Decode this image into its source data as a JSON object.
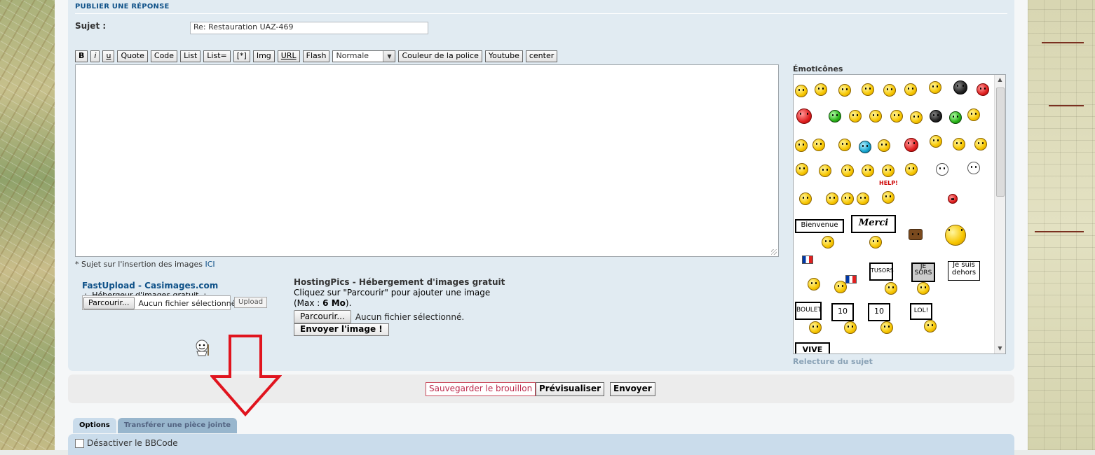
{
  "section": {
    "title": "PUBLIER UNE RÉPONSE"
  },
  "subject": {
    "label": "Sujet :",
    "value": "Re: Restauration UAZ-469"
  },
  "toolbar": {
    "bold": "B",
    "italic": "i",
    "underline": "u",
    "quote": "Quote",
    "code": "Code",
    "list": "List",
    "list_eq": "List=",
    "list_item": "[*]",
    "img": "Img",
    "url": "URL",
    "flash": "Flash",
    "font_size": "Normale",
    "font_color": "Couleur de la police",
    "youtube": "Youtube",
    "center": "center"
  },
  "note": {
    "text": "* Sujet sur l'insertion des images ",
    "link": "ICI"
  },
  "fastupload": {
    "title": "FastUpload - Casimages.com",
    "subtitle": ".:. Hébergeur d'images gratuit .:.",
    "browse": "Parcourir...",
    "no_file": "Aucun fichier sélectionné.",
    "upload": "Upload"
  },
  "hostingpics": {
    "title": "HostingPics - Hébergement d'images gratuit",
    "line1": "Cliquez sur \"Parcourir\" pour ajouter une image",
    "line2_prefix": "(Max : ",
    "line2_bold": "6 Mo",
    "line2_suffix": ").",
    "browse": "Parcourir...",
    "no_file": "Aucun fichier sélectionné.",
    "send": "Envoyer l'image !"
  },
  "emoticons": {
    "title": "Émoticônes",
    "signs": {
      "help": "HELP!",
      "bienvenue": "Bienvenue",
      "merci": "Merci",
      "tusors": "TUSORS",
      "jesors": "JE SORS",
      "dehors": "Je suis dehors",
      "boulet": "BOULET",
      "dix1": "10",
      "dix2": "10",
      "lol": "LOL!",
      "vive": "VIVE"
    }
  },
  "relecture": "Relecture du sujet",
  "buttons": {
    "draft": "Sauvegarder le brouillon",
    "preview": "Prévisualiser",
    "send": "Envoyer"
  },
  "tabs": {
    "options": "Options",
    "attach": "Transférer une pièce jointe"
  },
  "options": {
    "disable_bbcode": "Désactiver le BBCode"
  },
  "colors": {
    "link": "#105289",
    "panel": "#e1ebf2",
    "arrow": "#e0141e"
  }
}
